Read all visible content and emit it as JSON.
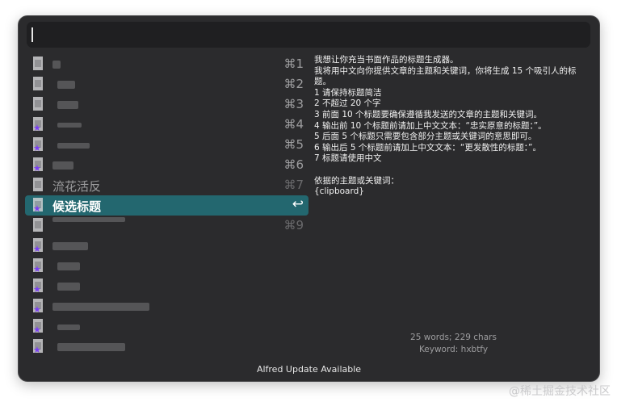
{
  "search": {
    "value": ""
  },
  "results": [
    {
      "shortcut": "⌘1"
    },
    {
      "shortcut": "⌘2"
    },
    {
      "shortcut": "⌘3"
    },
    {
      "shortcut": "⌘4"
    },
    {
      "shortcut": "⌘5"
    },
    {
      "shortcut": "⌘6"
    },
    {
      "shortcut": "⌘7",
      "label": "流花活反"
    },
    {
      "shortcut": "↩",
      "label": "候选标题",
      "selected": true
    },
    {
      "shortcut": "⌘9"
    }
  ],
  "preview": {
    "text": "我想让你充当书面作品的标题生成器。\n我将用中文向你提供文章的主题和关键词，你将生成 15 个吸引人的标题。\n1 请保持标题简洁\n2 不超过 20 个字\n3 前面 10 个标题要确保遵循我发送的文章的主题和关键词。\n4 输出前 10 个标题前请加上中文文本：“忠实原意的标题：”。\n5 后面 5 个标题只需要包含部分主题或关键词的意思即可。\n6 输出后 5 个标题前请加上中文文本：“更发散性的标题：”。\n7 标题请使用中文\n\n依据的主题或关键词：\n{clipboard}",
    "stats": "25 words; 229 chars",
    "keyword": "Keyword: hxbtfy"
  },
  "footer": "Alfred Update Available",
  "watermark": "@稀土掘金技术社区",
  "colors": {
    "window_bg": "#2b2b2d",
    "selected_row": "#23676f",
    "icon_accent": "#7b3ff2"
  }
}
